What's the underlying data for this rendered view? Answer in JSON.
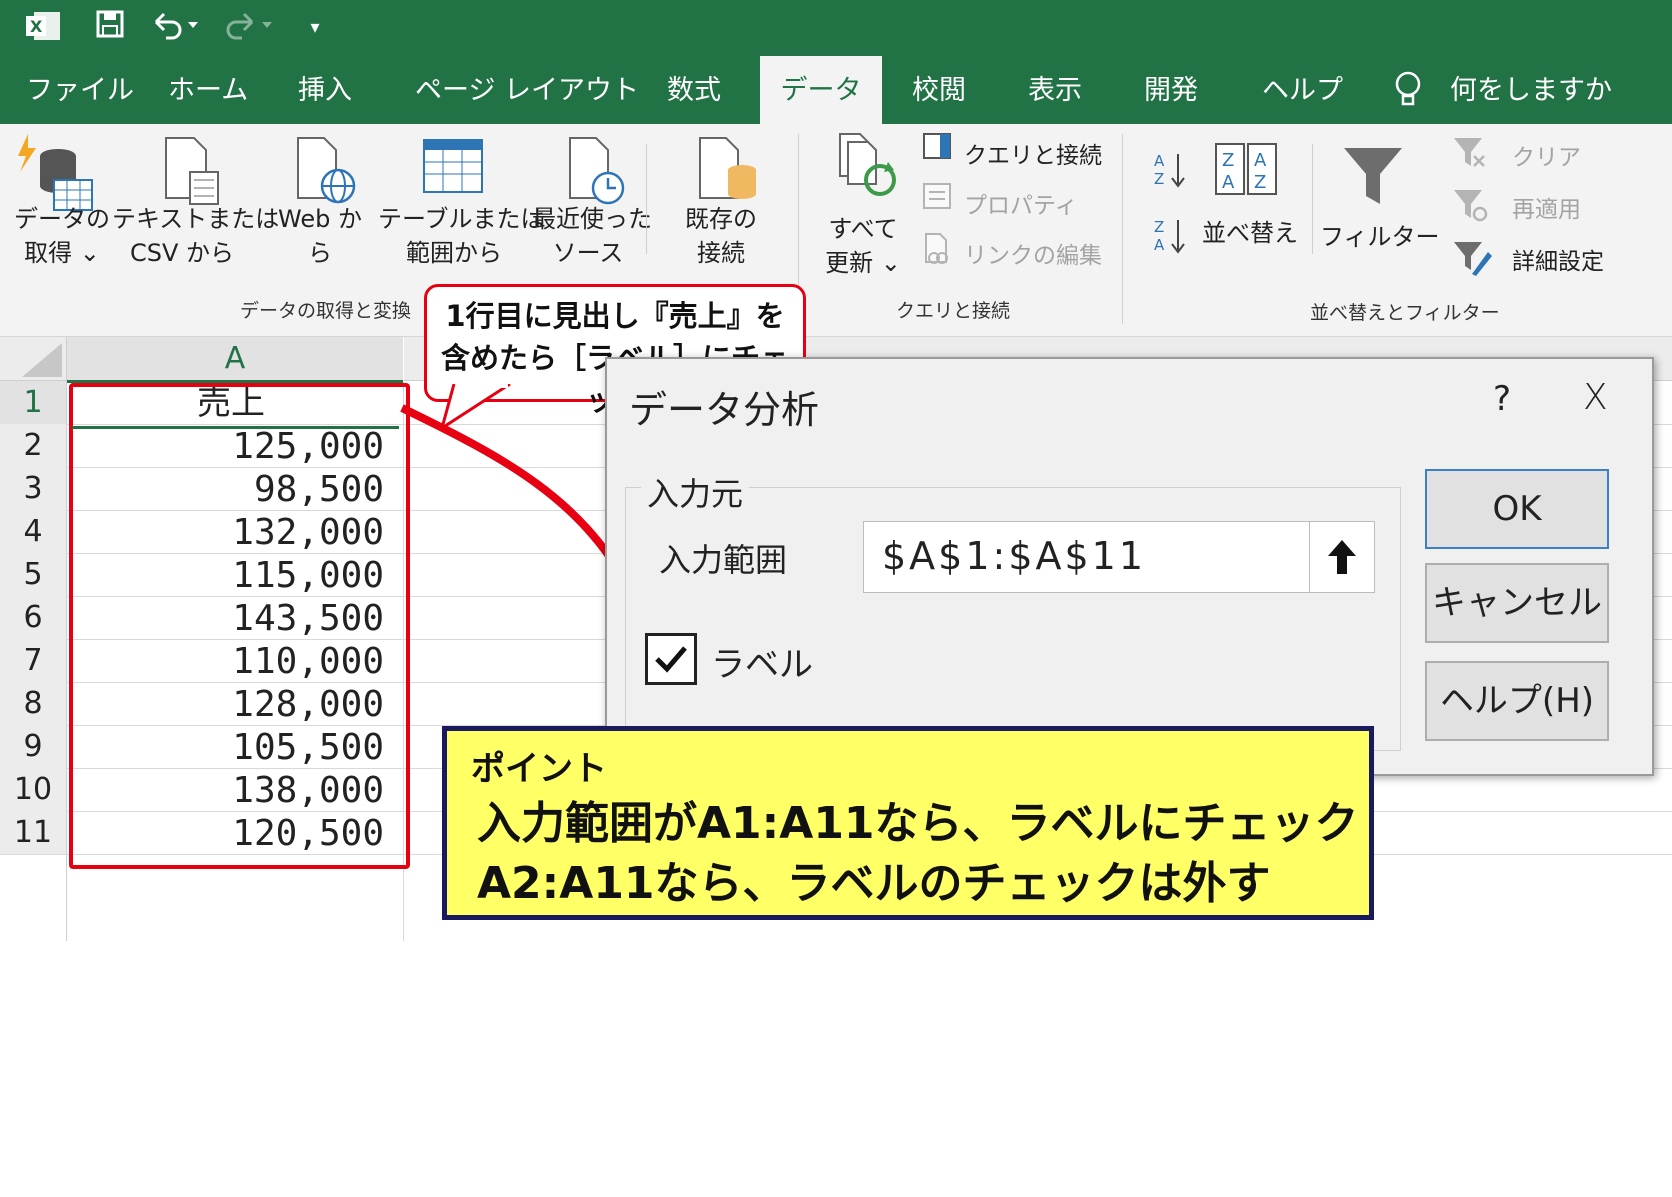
{
  "quick_access": {
    "more": "▾"
  },
  "tabs": [
    "ファイル",
    "ホーム",
    "挿入",
    "ページ レイアウト",
    "数式",
    "データ",
    "校閲",
    "表示",
    "開発",
    "ヘルプ"
  ],
  "tell_me": "何をしますか",
  "ribbon": {
    "get_data": {
      "line1": "データの",
      "line2": "取得 ⌄"
    },
    "text_csv": {
      "line1": "テキストまたは",
      "line2": "CSV から"
    },
    "web": {
      "line1": "Web か",
      "line2": "ら"
    },
    "table_range": {
      "line1": "テーブルまたは",
      "line2": "範囲から"
    },
    "recent": {
      "line1": "最近使った",
      "line2": "ソース"
    },
    "existing": {
      "line1": "既存の",
      "line2": "接続"
    },
    "group1": "データの取得と変換",
    "refresh_all": {
      "line1": "すべて",
      "line2": "更新 ⌄"
    },
    "queries_connections": "クエリと接続",
    "properties": "プロパティ",
    "edit_links": "リンクの編集",
    "group2": "クエリと接続",
    "sort": "並べ替え",
    "filter": "フィルター",
    "clear": "クリア",
    "reapply": "再適用",
    "advanced": "詳細設定",
    "group3": "並べ替えとフィルター"
  },
  "sheet": {
    "column_header": "A",
    "rows": [
      {
        "n": "1",
        "v": "売上"
      },
      {
        "n": "2",
        "v": "125,000"
      },
      {
        "n": "3",
        "v": "98,500"
      },
      {
        "n": "4",
        "v": "132,000"
      },
      {
        "n": "5",
        "v": "115,000"
      },
      {
        "n": "6",
        "v": "143,500"
      },
      {
        "n": "7",
        "v": "110,000"
      },
      {
        "n": "8",
        "v": "128,000"
      },
      {
        "n": "9",
        "v": "105,500"
      },
      {
        "n": "10",
        "v": "138,000"
      },
      {
        "n": "11",
        "v": "120,500"
      }
    ]
  },
  "dialog": {
    "title": "データ分析",
    "help": "?",
    "close": "X",
    "input_group": "入力元",
    "input_range_label": "入力範囲",
    "input_range_value": "$A$1:$A$11",
    "label_checkbox": "ラベル",
    "label_checked": true,
    "ok": "OK",
    "cancel": "キャンセル",
    "help_button": "ヘルプ(H)"
  },
  "callout_top": {
    "line1": "1行目に見出し『売上』を",
    "line2": "含めたら［ラベル］にチェック"
  },
  "callout_point": {
    "title": "ポイント",
    "line1": "入力範囲がA1:A11なら、ラベルにチェック",
    "line2": "A2:A11なら、ラベルのチェックは外す"
  },
  "colors": {
    "excel_green": "#217346",
    "highlight_red": "#e60012",
    "note_yellow": "#ffff66"
  }
}
